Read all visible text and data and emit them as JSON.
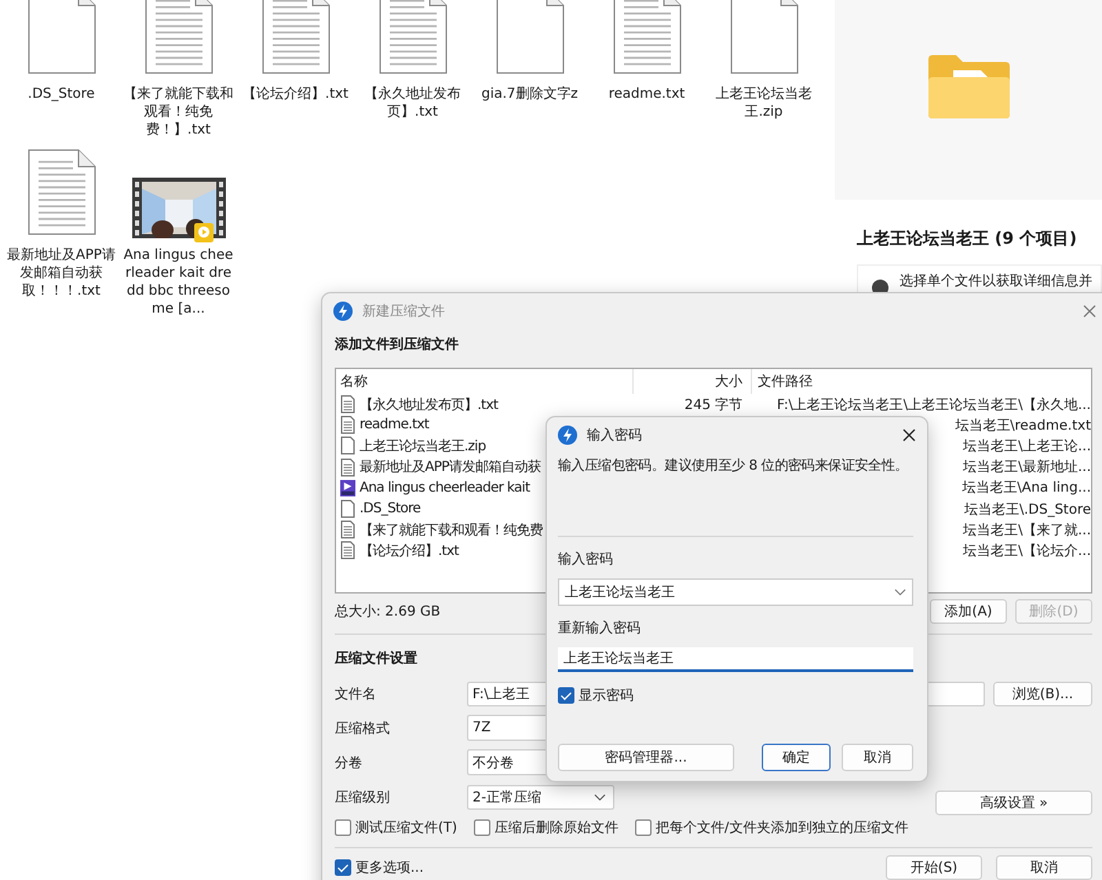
{
  "desktop": {
    "files": [
      {
        "name": ".DS_Store",
        "kind": "blank"
      },
      {
        "name": "【来了就能下载和观看！纯免费！】.txt",
        "kind": "text"
      },
      {
        "name": "【论坛介绍】.txt",
        "kind": "text"
      },
      {
        "name": "【永久地址发布页】.txt",
        "kind": "text"
      },
      {
        "name": "gia.7删除文字z",
        "kind": "blank"
      },
      {
        "name": "readme.txt",
        "kind": "text"
      },
      {
        "name": "上老王论坛当老王.zip",
        "kind": "blank"
      },
      {
        "name": "最新地址及APP请发邮箱自动获取！！！.txt",
        "kind": "text"
      },
      {
        "name": "Ana lingus cheerleader kait dredd bbc threesome [a...",
        "kind": "video"
      }
    ]
  },
  "details_pane": {
    "title": "上老王论坛当老王 (9 个项目)",
    "info": "选择单个文件以获取详细信息并"
  },
  "archive_dialog": {
    "title": "新建压缩文件",
    "heading": "添加文件到压缩文件",
    "columns": [
      "名称",
      "大小",
      "文件路径"
    ],
    "rows": [
      {
        "name": "【永久地址发布页】.txt",
        "kind": "text",
        "size": "245 字节",
        "path": "F:\\上老王论坛当老王\\上老王论坛当老王\\【永久地..."
      },
      {
        "name": "readme.txt",
        "kind": "text",
        "path": "坛当老王\\readme.txt"
      },
      {
        "name": "上老王论坛当老王.zip",
        "kind": "blank",
        "path": "坛当老王\\上老王论..."
      },
      {
        "name": "最新地址及APP请发邮箱自动获",
        "kind": "text",
        "path": "坛当老王\\最新地址..."
      },
      {
        "name": "Ana lingus cheerleader kait",
        "kind": "video",
        "path": "坛当老王\\Ana ling..."
      },
      {
        "name": ".DS_Store",
        "kind": "blank",
        "path": "坛当老王\\.DS_Store"
      },
      {
        "name": "【来了就能下载和观看！纯免费",
        "kind": "text",
        "path": "坛当老王\\【来了就..."
      },
      {
        "name": "【论坛介绍】.txt",
        "kind": "text",
        "path": "坛当老王\\【论坛介..."
      }
    ],
    "total": "总大小: 2.69 GB",
    "list_buttons": [
      {
        "label": "添加(A)",
        "disabled": false
      },
      {
        "label": "删除(D)",
        "disabled": true
      }
    ],
    "settings_heading": "压缩文件设置",
    "fields": [
      {
        "label": "文件名",
        "value": "F:\\上老王",
        "kind": "text",
        "button": "浏览(B)..."
      },
      {
        "label": "压缩格式",
        "value": "7Z",
        "kind": "short"
      },
      {
        "label": "分卷",
        "value": "不分卷",
        "kind": "short"
      },
      {
        "label": "压缩级别",
        "value": "2-正常压缩",
        "kind": "select",
        "button": "高级设置 »"
      }
    ],
    "options": [
      {
        "label": "测试压缩文件(T)",
        "checked": false
      },
      {
        "label": "压缩后删除原始文件",
        "checked": false
      },
      {
        "label": "把每个文件/文件夹添加到独立的压缩文件",
        "checked": false
      }
    ],
    "more_options": {
      "label": "更多选项...",
      "checked": true
    },
    "footer_buttons": [
      "开始(S)",
      "取消"
    ]
  },
  "password_dialog": {
    "title": "输入密码",
    "message": "输入压缩包密码。建议使用至少 8 位的密码来保证安全性。",
    "password_label": "输入密码",
    "password": "上老王论坛当老王",
    "confirm_label": "重新输入密码",
    "confirm": "上老王论坛当老王",
    "show_password": {
      "label": "显示密码",
      "checked": true
    },
    "buttons": [
      {
        "label": "密码管理器...",
        "selected": false
      },
      {
        "label": "确定",
        "selected": true
      },
      {
        "label": "取消",
        "selected": false
      }
    ]
  }
}
